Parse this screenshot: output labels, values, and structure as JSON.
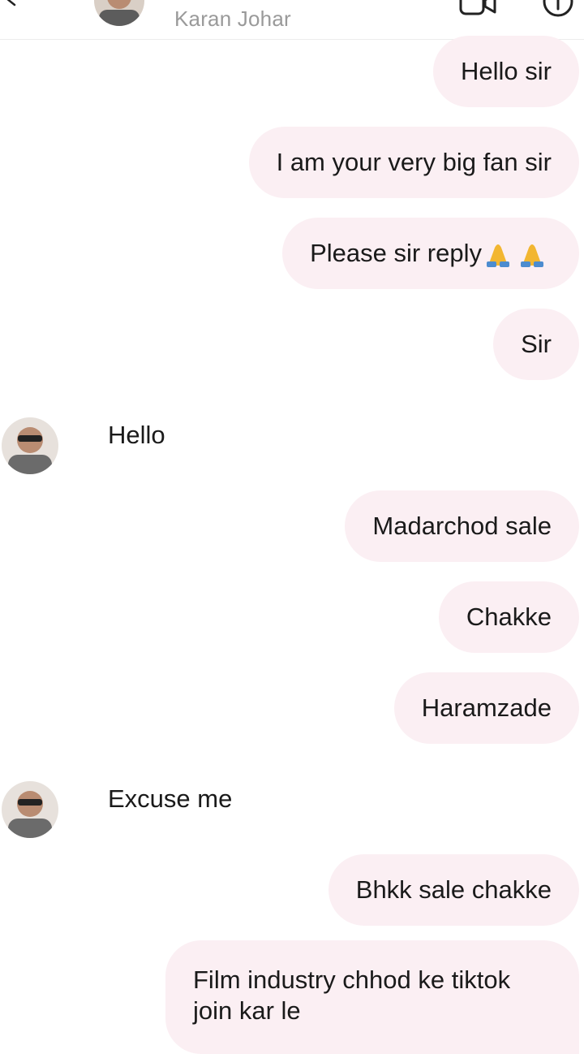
{
  "header": {
    "contact_name": "Karan Johar"
  },
  "messages": [
    {
      "side": "out",
      "text": "Hello sir"
    },
    {
      "side": "out",
      "text": "I am your very big fan sir"
    },
    {
      "side": "out",
      "text": "Please sir reply",
      "emoji": "folded-hands x2"
    },
    {
      "side": "out",
      "text": "Sir"
    },
    {
      "side": "in",
      "text": "Hello"
    },
    {
      "side": "out",
      "text": "Madarchod sale"
    },
    {
      "side": "out",
      "text": "Chakke"
    },
    {
      "side": "out",
      "text": "Haramzade"
    },
    {
      "side": "in",
      "text": "Excuse me"
    },
    {
      "side": "out",
      "text": "Bhkk sale chakke"
    },
    {
      "side": "out",
      "text": "Film industry chhod ke tiktok join kar le"
    }
  ],
  "colors": {
    "bubble_bg": "#fbeff3",
    "header_name": "#9a9a9a",
    "emoji_hands": "#f2b631"
  },
  "icons": [
    "back-arrow-icon",
    "video-call-icon",
    "info-icon"
  ]
}
